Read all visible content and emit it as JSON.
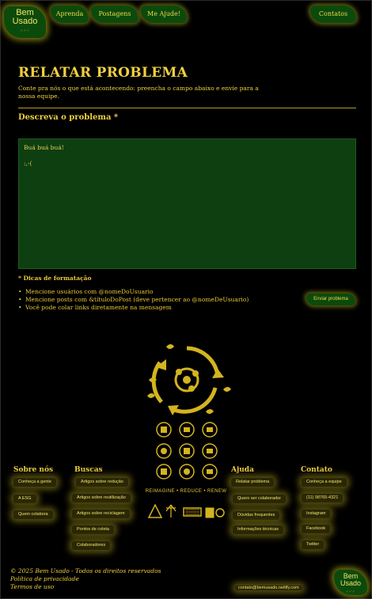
{
  "header": {
    "logo_line1": "Bem",
    "logo_line2": "Usado",
    "logo_leaves": "⸝⸝⸝",
    "nav": [
      "Aprenda",
      "Postagens",
      "Me Ajude!",
      "Contatos"
    ]
  },
  "page": {
    "title": "RELATAR PROBLEMA",
    "intro": "Conte pra nós o que está acontecendo: preencha o campo abaixo e envie para a nossa equipe.",
    "field_label": "Descreva o problema *",
    "textarea_value": "Buá buá buá!\n\n:,-(",
    "tips_title": "* Dicas de formatação",
    "tips": [
      "Mencione usuários com @nomeDoUsuario",
      "Mencione posts com &títuloDoPost (deve pertencer ao @nomeDeUsuario)",
      "Você pode colar links diretamente na mensagem"
    ],
    "submit_label": "Enviar problema"
  },
  "emblem": {
    "tagline": "REIMAGINE • REDUCE • RENEW",
    "colors": {
      "gold": "#d4b41e",
      "green": "#0c4a0c"
    }
  },
  "footer": {
    "columns": [
      {
        "heading": "Sobre nós",
        "links": [
          "Conheça a gente",
          "A ESG",
          "Quem colabora"
        ]
      },
      {
        "heading": "Buscas",
        "links": [
          "Artigos sobre redução",
          "Artigos sobre reutilização",
          "Artigos sobre reciclagem",
          "Pontos de coleta",
          "Colaboradores"
        ]
      },
      {
        "heading": "Ajuda",
        "links": [
          "Relatar problema",
          "Quero ser colaborador",
          "Dúvidas frequentes",
          "Informações técnicas"
        ]
      },
      {
        "heading": "Contato",
        "links": [
          "Conheça a equipe",
          "(11) 98765-4321",
          "Instagram",
          "Facebook",
          "Twitter"
        ]
      }
    ],
    "copyright": "© 2025 Bem Usado - Todos os direitos reservados",
    "privacy": "Política de privacidade",
    "terms": "Termos de uso",
    "email": "contato@bemusado.netlify.com"
  }
}
